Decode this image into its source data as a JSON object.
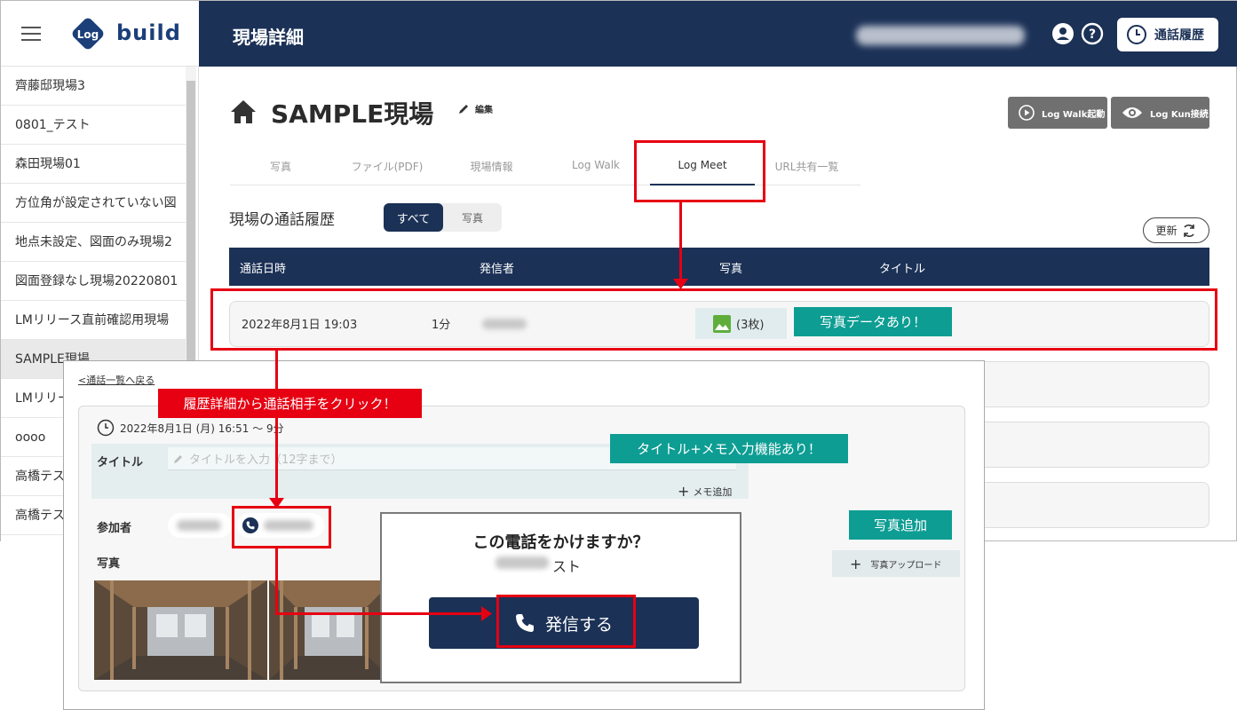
{
  "app": {
    "logo_text": "build",
    "page_title": "現場詳細",
    "history_button": "通話履歴"
  },
  "sidebar": {
    "items": [
      {
        "label": "齊藤邸現場3"
      },
      {
        "label": "0801_テスト"
      },
      {
        "label": "森田現場01"
      },
      {
        "label": "方位角が設定されていない図"
      },
      {
        "label": "地点未設定、図面のみ現場2"
      },
      {
        "label": "図面登録なし現場20220801"
      },
      {
        "label": "LMリリース直前確認用現場"
      },
      {
        "label": "SAMPLE現場"
      },
      {
        "label": "LMリリース"
      },
      {
        "label": "oooo"
      },
      {
        "label": "高橋テスト"
      },
      {
        "label": "高橋テスト"
      }
    ]
  },
  "site": {
    "title": "SAMPLE現場",
    "edit_label": "編集",
    "logwalk_button": "Log Walk起動",
    "logkun_button": "Log Kun接続"
  },
  "tabs": [
    {
      "label": "写真"
    },
    {
      "label": "ファイル(PDF)"
    },
    {
      "label": "現場情報"
    },
    {
      "label": "Log Walk"
    },
    {
      "label": "Log Meet"
    },
    {
      "label": "URL共有一覧"
    }
  ],
  "history": {
    "section_title": "現場の通話履歴",
    "filter_all": "すべて",
    "filter_photo": "写真",
    "refresh": "更新",
    "columns": [
      "通話日時",
      "発信者",
      "写真",
      "タイトル"
    ],
    "row": {
      "datetime": "2022年8月1日 19:03",
      "duration": "1分",
      "photo_count": "(3枚)"
    }
  },
  "detail": {
    "back_link": "<通話一覧へ戻る",
    "datetime": "2022年8月1日 (月) 16:51 〜 9分",
    "title_label": "タイトル",
    "title_placeholder": "タイトルを入力（12字まで）",
    "memo_add": "メモ追加",
    "participants_label": "参加者",
    "photos_label": "写真",
    "upload": "写真アップロード"
  },
  "dialog": {
    "question": "この電話をかけますか？",
    "name_suffix": "スト",
    "call_button": "発信する"
  },
  "annotations": {
    "photo_data": "写真データあり！",
    "click_hint": "履歴詳細から通話相手をクリック！",
    "title_memo": "タイトル+メモ入力機能あり！",
    "photo_add": "写真追加"
  },
  "colors": {
    "navy": "#1b3156",
    "teal": "#0d9d93",
    "annotation_red": "#e60012"
  }
}
